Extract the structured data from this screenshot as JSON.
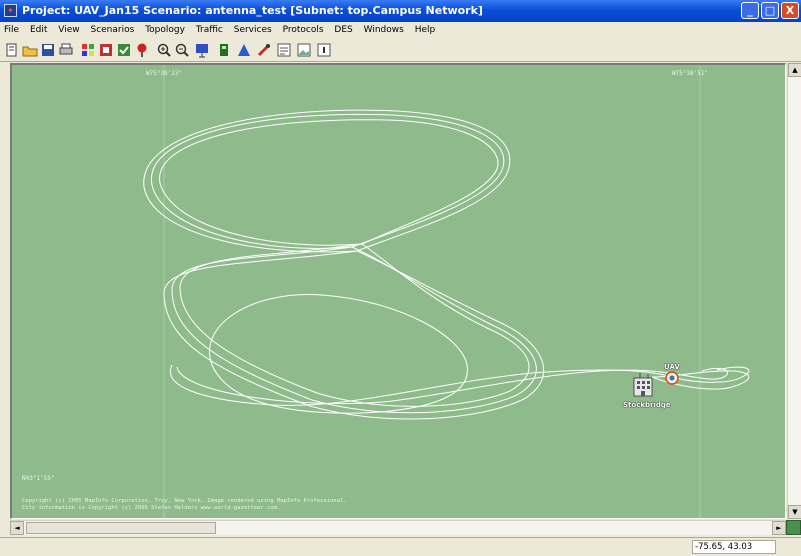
{
  "window": {
    "title": "Project: UAV_Jan15 Scenario: antenna_test  [Subnet: top.Campus Network]",
    "minimize_glyph": "_",
    "maximize_glyph": "□",
    "close_glyph": "X"
  },
  "menu": [
    "File",
    "Edit",
    "View",
    "Scenarios",
    "Topology",
    "Traffic",
    "Services",
    "Protocols",
    "DES",
    "Windows",
    "Help"
  ],
  "toolbar_icons": [
    "new-project-icon",
    "open-folder-icon",
    "save-icon",
    "print-icon",
    "palette-icon",
    "configure-icon",
    "check-model-icon",
    "fail-node-icon",
    "zoom-in-icon",
    "zoom-out-icon",
    "run-simulation-icon",
    "view-results-icon",
    "statistics-icon",
    "clear-icon",
    "web-report-icon",
    "image-icon",
    "info-icon"
  ],
  "map": {
    "coord_top_left": "W75°39'23\"",
    "coord_top_right": "W75°38'51\"",
    "coord_bottom_left": "N43°1'55\"",
    "copyright_line1": "Copyright (c) 2005 MapInfo Corporation, Troy, New York. Image rendered using MapInfo Professional.",
    "copyright_line2": "City information is Copyright (c) 2005 Stefan Helders www.world-gazetteer.com.",
    "uav_label": "UAV",
    "station_label": "Stockbridge",
    "colors": {
      "background": "#8fbb8c",
      "track": "#ffffff"
    }
  },
  "status": {
    "coordinates": "-75.65, 43.03"
  },
  "scroll": {
    "left_arrow": "◄",
    "right_arrow": "►",
    "up_arrow": "▲",
    "down_arrow": "▼"
  }
}
